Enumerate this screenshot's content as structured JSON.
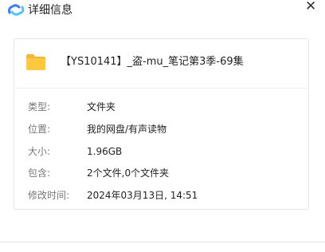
{
  "window": {
    "title": "详细信息",
    "close_icon": "close-icon",
    "logo_icon": "cloud-logo-icon"
  },
  "file": {
    "icon": "folder-icon",
    "name": "【YS10141】_盗-mu_笔记第3季-69集"
  },
  "details": [
    {
      "label": "类型:",
      "value": "文件夹"
    },
    {
      "label": "位置:",
      "value": "我的网盘/有声读物"
    },
    {
      "label": "大小:",
      "value": "1.96GB"
    },
    {
      "label": "包含:",
      "value": "2个文件,0个文件夹"
    },
    {
      "label": "修改时间:",
      "value": "2024年03月13日, 14:51"
    }
  ],
  "colors": {
    "folder": "#ffc83d",
    "folder_back": "#f4b53a",
    "logo_blue": "#3d7ef7",
    "logo_cyan": "#4fc3f7"
  }
}
